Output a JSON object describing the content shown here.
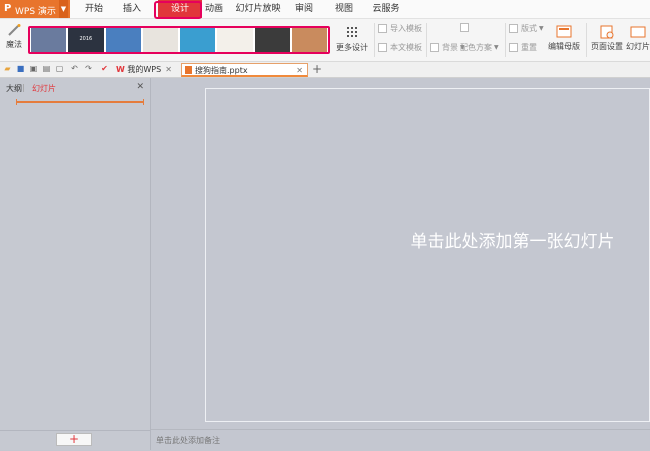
{
  "app": {
    "name": "WPS 演示",
    "logo": "P",
    "accent": "#e8742c"
  },
  "menu": {
    "tabs": [
      "开始",
      "插入",
      "设计",
      "动画",
      "幻灯片放映",
      "审阅",
      "视图",
      "云服务"
    ],
    "active": "设计",
    "active_color": "#e1363b"
  },
  "ribbon": {
    "magic": "魔法",
    "templates": [
      "",
      "2016",
      "",
      "",
      "",
      "",
      "",
      ""
    ],
    "more_design": "更多设计",
    "import_template": "导入模板",
    "body_template": "本文模板",
    "background": "背景",
    "color_scheme": "配色方案",
    "layout": "版式",
    "reset": "重置",
    "edit_master": "编辑母版",
    "page_setup": "页面设置",
    "slide_size": "幻灯片"
  },
  "doc_tabs": {
    "home": "我的WPS",
    "current": "搜狗指南.pptx"
  },
  "left_panel": {
    "outline": "大纲",
    "divider": "|",
    "slides": "幻灯片",
    "add": "+"
  },
  "slide": {
    "placeholder": "单击此处添加第一张幻灯片"
  },
  "notes": {
    "placeholder": "单击此处添加备注"
  },
  "highlight_color": "#e6005c"
}
